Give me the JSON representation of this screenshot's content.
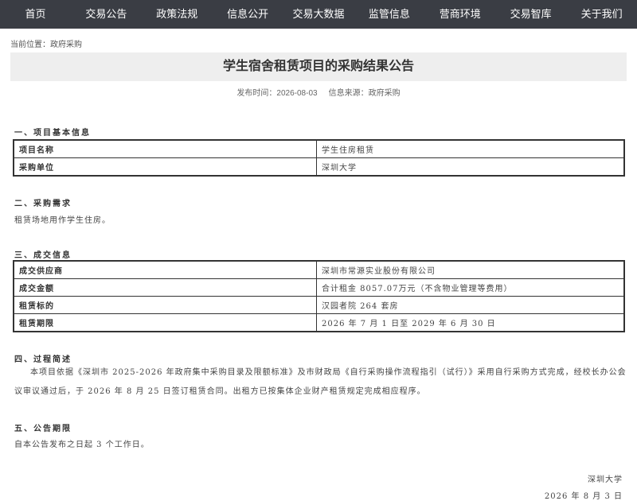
{
  "nav": {
    "items": [
      {
        "label": "首页"
      },
      {
        "label": "交易公告"
      },
      {
        "label": "政策法规"
      },
      {
        "label": "信息公开"
      },
      {
        "label": "交易大数据"
      },
      {
        "label": "监管信息"
      },
      {
        "label": "营商环境"
      },
      {
        "label": "交易智库"
      },
      {
        "label": "关于我们"
      }
    ]
  },
  "breadcrumb": {
    "prefix": "当前位置：",
    "current": "政府采购"
  },
  "article": {
    "title": "学生宿舍租赁项目的采购结果公告",
    "publish_label": "发布时间：",
    "publish_date": "2026-08-03",
    "source_label": "信息来源：",
    "source": "政府采购"
  },
  "section1": {
    "heading": "一、项目基本信息",
    "rows": [
      {
        "key": "项目名称",
        "value": "学生住房租赁"
      },
      {
        "key": "采购单位",
        "value": "深圳大学"
      }
    ]
  },
  "section2": {
    "heading": "二、采购需求",
    "text": "租赁场地用作学生住房。"
  },
  "section3": {
    "heading": "三、成交信息",
    "rows": [
      {
        "key": "成交供应商",
        "value": "深圳市常源实业股份有限公司"
      },
      {
        "key": "成交金额",
        "value": "合计租金 8057.07万元（不含物业管理等费用）"
      },
      {
        "key": "租赁标的",
        "value": "汉园者院 264 套房"
      },
      {
        "key": "租赁期限",
        "value": "2026 年 7 月 1 日至 2029 年 6 月 30 日"
      }
    ]
  },
  "section4": {
    "heading": "四、过程简述",
    "text": "本项目依据《深圳市 2025-2026 年政府集中采购目录及限额标准》及市财政局《自行采购操作流程指引（试行）》采用自行采购方式完成，经校长办公会议审议通过后，于 2026 年 8 月 25 日签订租赁合同。出租方已按集体企业财产租赁规定完成相应程序。"
  },
  "section5": {
    "heading": "五、公告期限",
    "text": "自本公告发布之日起 3 个工作日。"
  },
  "signature": {
    "org": "深圳大学",
    "date": "2026 年 8 月 3 日"
  }
}
